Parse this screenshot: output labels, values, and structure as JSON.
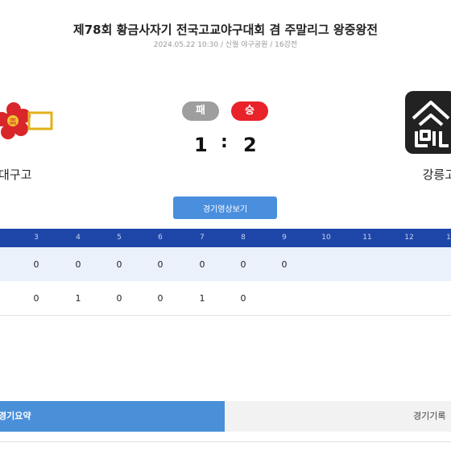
{
  "header": {
    "title": "제78회 황금사자기 전국고교야구대회 겸 주말리그 왕중왕전",
    "subtitle": "2024.05.22 10:30 / 신월 야구공원 / 16강전"
  },
  "teams": {
    "left": {
      "name": "대구고",
      "result": "패",
      "score": "1"
    },
    "right": {
      "name": "강릉고",
      "result": "승",
      "score": "2"
    },
    "separator": ":"
  },
  "video_button": "경기영상보기",
  "scoreboard": {
    "innings": [
      "3",
      "4",
      "5",
      "6",
      "7",
      "8",
      "9",
      "10",
      "11",
      "12",
      "1"
    ],
    "row_a": [
      "0",
      "0",
      "0",
      "0",
      "0",
      "0",
      "0"
    ],
    "row_b": [
      "0",
      "1",
      "0",
      "0",
      "1",
      "0"
    ]
  },
  "tabs": {
    "summary": "경기요약",
    "record": "경기기록"
  },
  "colors": {
    "loss_badge": "#9e9e9e",
    "win_badge": "#e8232a",
    "header_bar": "#1e46a8",
    "active_tab": "#4a90d9",
    "button": "#4a8fde"
  }
}
